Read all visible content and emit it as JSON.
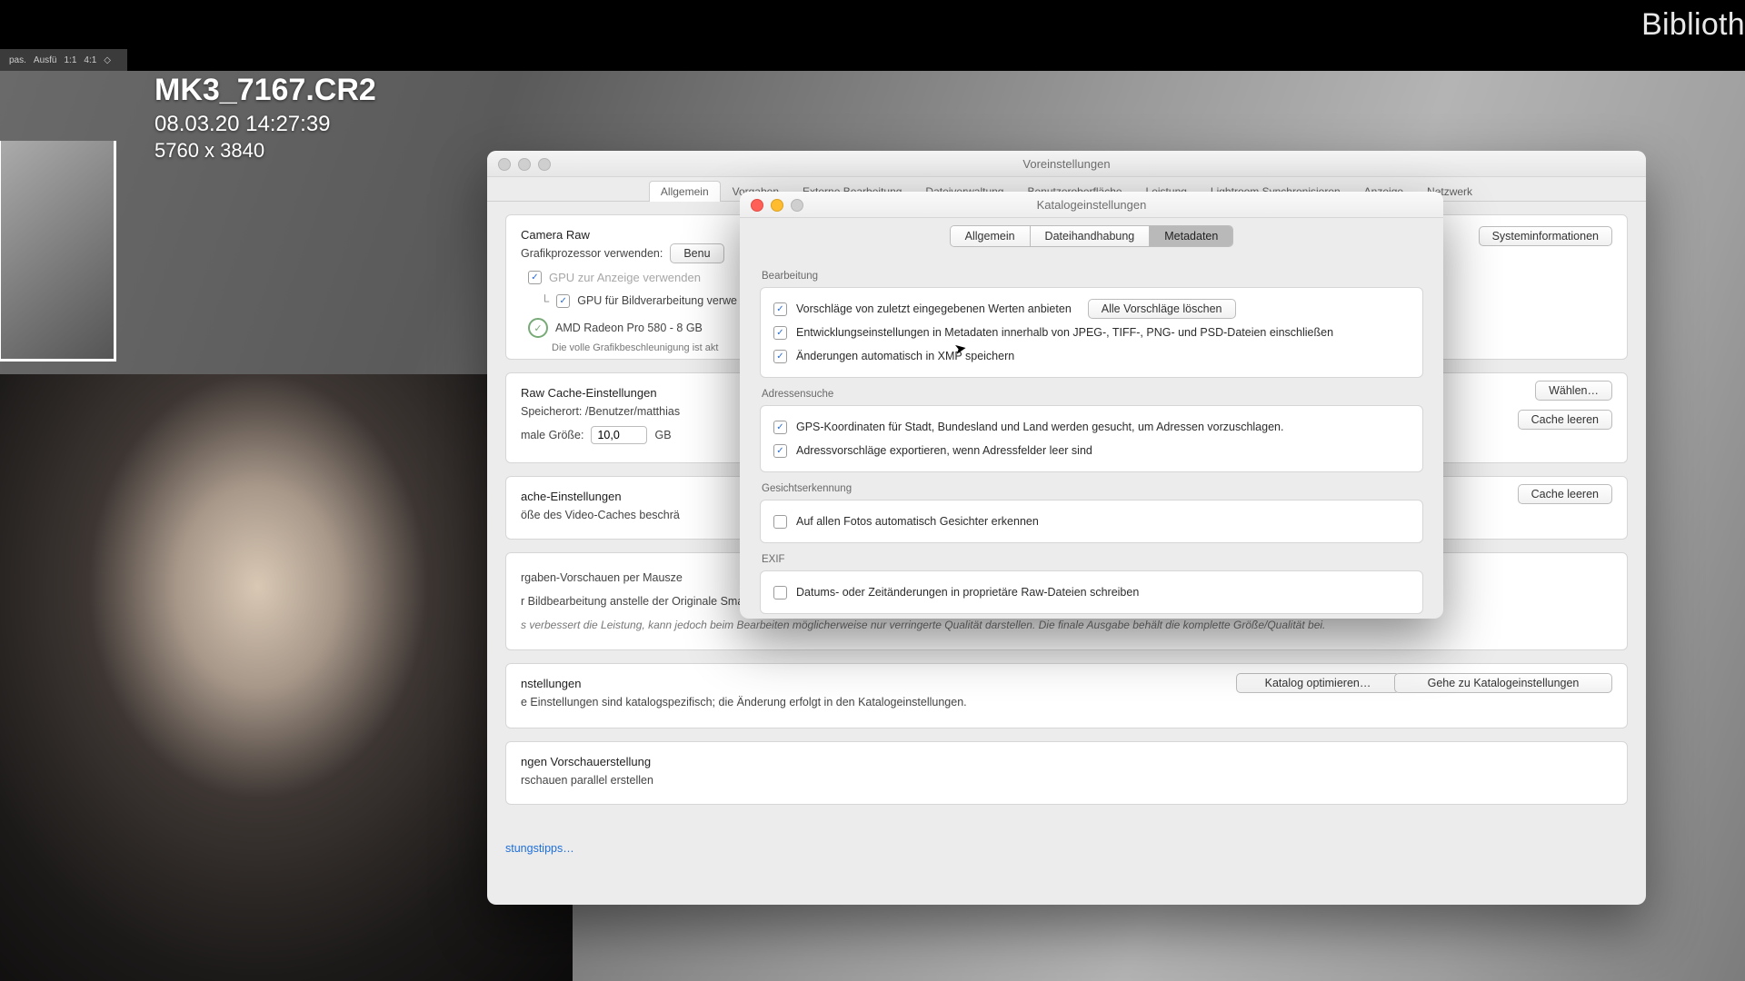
{
  "topbar": {
    "right_label": "Biblioth"
  },
  "toolstrip": {
    "a": "pas.",
    "b": "Ausfü",
    "c": "1:1",
    "d": "4:1",
    "e": "◇"
  },
  "file": {
    "name": "MK3_7167.CR2",
    "date": "08.03.20 14:27:39",
    "dim": "5760 x 3840"
  },
  "prefs": {
    "title": "Voreinstellungen",
    "tabs": [
      "Allgemein",
      "Vorgaben",
      "Externe Bearbeitung",
      "Dateiverwaltung",
      "Benutzeroberfläche",
      "Leistung",
      "Lightroom Synchronisieren",
      "Anzeige",
      "Netzwerk"
    ],
    "active_tab": 0,
    "sysinfo_btn": "Systeminformationen",
    "cameraraw": {
      "legend": "Camera Raw",
      "gpu_label": "Grafikprozessor verwenden:",
      "gpu_select": "Benu",
      "cb1": "GPU zur Anzeige verwenden",
      "cb2": "GPU für Bildverarbeitung verwe",
      "gpu_model": "AMD Radeon Pro 580 - 8 GB",
      "gpu_note": "Die volle Grafikbeschleunigung ist akt"
    },
    "rawcache": {
      "legend": "Raw Cache-Einstellungen",
      "path_label": "Speicherort:  /Benutzer/matthias",
      "size_label": "male Größe:",
      "size_value": "10,0",
      "size_unit": "GB",
      "choose_btn": "Wählen…",
      "clear_btn": "Cache leeren"
    },
    "videocache": {
      "legend": "ache-Einstellungen",
      "limit_label": "öße des Video-Caches beschrä",
      "clear_btn": "Cache leeren"
    },
    "smart": {
      "legend": "",
      "l1": "rgaben-Vorschauen per Mausze",
      "l2": "r Bildbearbeitung anstelle der Originale Smart-Vorschau verwenden",
      "note": "s verbessert die Leistung, kann jedoch beim Bearbeiten möglicherweise nur verringerte Qualität darstellen. Die finale Ausgabe behält die komplette Größe/Qualität bei."
    },
    "catalog_settings": {
      "legend": "nstellungen",
      "text": "e Einstellungen sind katalogspezifisch; die Änderung erfolgt in den Katalogeinstellungen.",
      "opt_btn": "Katalog optimieren…",
      "goto_btn": "Gehe zu Katalogeinstellungen"
    },
    "preview_gen": {
      "legend": "ngen Vorschauerstellung",
      "text": "rschauen parallel erstellen"
    },
    "tips_link": "stungstipps…"
  },
  "catalog": {
    "title": "Katalogeinstellungen",
    "segments": [
      "Allgemein",
      "Dateihandhabung",
      "Metadaten"
    ],
    "active_seg": 2,
    "edit": {
      "label": "Bearbeitung",
      "c1": "Vorschläge von zuletzt eingegebenen Werten anbieten",
      "btn1": "Alle Vorschläge löschen",
      "c2": "Entwicklungseinstellungen in Metadaten innerhalb von JPEG-, TIFF-, PNG- und PSD-Dateien einschließen",
      "c3": "Änderungen automatisch in XMP speichern"
    },
    "addr": {
      "label": "Adressensuche",
      "c1": "GPS-Koordinaten für Stadt, Bundesland und Land werden gesucht, um Adressen vorzuschlagen.",
      "c2": "Adressvorschläge exportieren, wenn Adressfelder leer sind"
    },
    "face": {
      "label": "Gesichtserkennung",
      "c1": "Auf allen Fotos automatisch Gesichter erkennen"
    },
    "exif": {
      "label": "EXIF",
      "c1": "Datums- oder Zeitänderungen in proprietäre Raw-Dateien schreiben"
    }
  }
}
